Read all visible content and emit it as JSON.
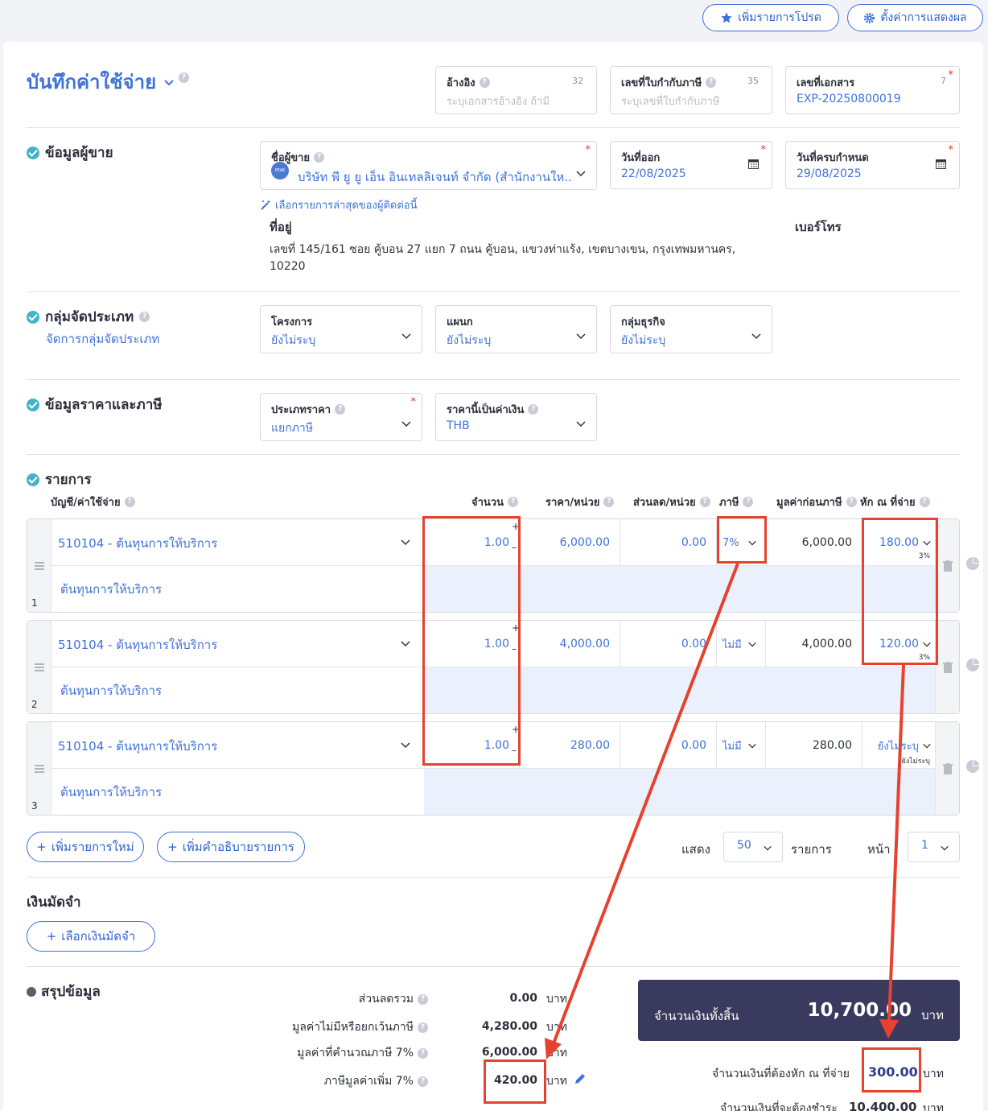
{
  "top": {
    "fav_label": "เพิ่มรายการโปรด",
    "settings_label": "ตั้งค่าการแสดงผล"
  },
  "header": {
    "title": "บันทึกค่าใช้จ่าย",
    "ref": {
      "label": "อ้างอิง",
      "count": "32",
      "placeholder": "ระบุเอกสารอ้างอิง ถ้ามี"
    },
    "tax_invoice": {
      "label": "เลขที่ใบกำกับภาษี",
      "count": "35",
      "placeholder": "ระบุเลขที่ใบกำกับภาษี"
    },
    "doc_no": {
      "label": "เลขที่เอกสาร",
      "count": "7",
      "value": "EXP-20250800019"
    }
  },
  "vendor": {
    "section_title": "ข้อมูลผู้ขาย",
    "name_label": "ชื่อผู้ขาย",
    "name_value": "บริษัท พี ยู ยู เอ็น อินเทลลิเจนท์ จำกัด (สำนักงานให...",
    "logo_text": "PEAK",
    "issue_label": "วันที่ออก",
    "issue_value": "22/08/2025",
    "due_label": "วันที่ครบกำหนด",
    "due_value": "29/08/2025",
    "latest_link": "เลือกรายการล่าสุดของผู้ติดต่อนี้",
    "address_label": "ที่อยู่",
    "address_line1": "เลขที่ 145/161 ซอย คู้บอน 27 แยก 7 ถนน คู้บอน, แขวงท่าแร้ง, เขตบางเขน, กรุงเทพมหานคร,",
    "address_line2": "10220",
    "phone_label": "เบอร์โทร"
  },
  "category": {
    "section_title": "กลุ่มจัดประเภท",
    "manage_link": "จัดการกลุ่มจัดประเภท",
    "project_label": "โครงการ",
    "project_value": "ยังไม่ระบุ",
    "dept_label": "แผนก",
    "dept_value": "ยังไม่ระบุ",
    "biz_label": "กลุ่มธุรกิจ",
    "biz_value": "ยังไม่ระบุ"
  },
  "pricing": {
    "section_title": "ข้อมูลราคาและภาษี",
    "price_type_label": "ประเภทราคา",
    "price_type_value": "แยกภาษี",
    "currency_label": "ราคานี้เป็นค่าเงิน",
    "currency_value": "THB"
  },
  "items": {
    "section_title": "รายการ",
    "headers": {
      "account": "บัญชี/ค่าใช้จ่าย",
      "qty": "จำนวน",
      "price": "ราคา/หน่วย",
      "discount": "ส่วนลด/หน่วย",
      "tax": "ภาษี",
      "pretax": "มูลค่าก่อนภาษี",
      "wht": "หัก ณ ที่จ่าย"
    },
    "rows": [
      {
        "no": "1",
        "account": "510104 - ต้นทุนการให้บริการ",
        "desc": "ต้นทุนการให้บริการ",
        "qty": "1.00",
        "price": "6,000.00",
        "discount": "0.00",
        "tax": "7%",
        "pretax": "6,000.00",
        "wht": "180.00",
        "wht_rate": "3%"
      },
      {
        "no": "2",
        "account": "510104 - ต้นทุนการให้บริการ",
        "desc": "ต้นทุนการให้บริการ",
        "qty": "1.00",
        "price": "4,000.00",
        "discount": "0.00",
        "tax": "ไม่มี",
        "pretax": "4,000.00",
        "wht": "120.00",
        "wht_rate": "3%"
      },
      {
        "no": "3",
        "account": "510104 - ต้นทุนการให้บริการ",
        "desc": "ต้นทุนการให้บริการ",
        "qty": "1.00",
        "price": "280.00",
        "discount": "0.00",
        "tax": "ไม่มี",
        "pretax": "280.00",
        "wht": "ยังไม่ระบุ",
        "wht_rate": "ยังไม่ระบุ"
      }
    ],
    "add_item": "เพิ่มรายการใหม่",
    "add_desc": "เพิ่มคำอธิบายรายการ",
    "show_label": "แสดง",
    "show_value": "50",
    "items_label": "รายการ",
    "page_label": "หน้า",
    "page_value": "1"
  },
  "deposit": {
    "title": "เงินมัดจำ",
    "select_button": "เลือกเงินมัดจำ"
  },
  "summary": {
    "title": "สรุปข้อมูล",
    "discount_label": "ส่วนลดรวม",
    "discount_value": "0.00",
    "nontax_label": "มูลค่าไม่มีหรือยกเว้นภาษี",
    "nontax_value": "4,280.00",
    "taxable_label": "มูลค่าที่คำนวณภาษี 7%",
    "taxable_value": "6,000.00",
    "vat_label": "ภาษีมูลค่าเพิ่ม 7%",
    "vat_value": "420.00",
    "unit": "บาท",
    "total_label": "จำนวนเงินทั้งสิ้น",
    "total_value": "10,700.00",
    "wht_label": "จำนวนเงินที่ต้องหัก ณ ที่จ่าย",
    "wht_value": "300.00",
    "pay_label": "จำนวนเงินที่จะต้องชำระ",
    "pay_value": "10,400.00"
  },
  "colors": {
    "accent": "#3e72d8",
    "annotation": "#e5432f",
    "total_bg": "#3a3a5e",
    "check": "#44b3c7"
  }
}
